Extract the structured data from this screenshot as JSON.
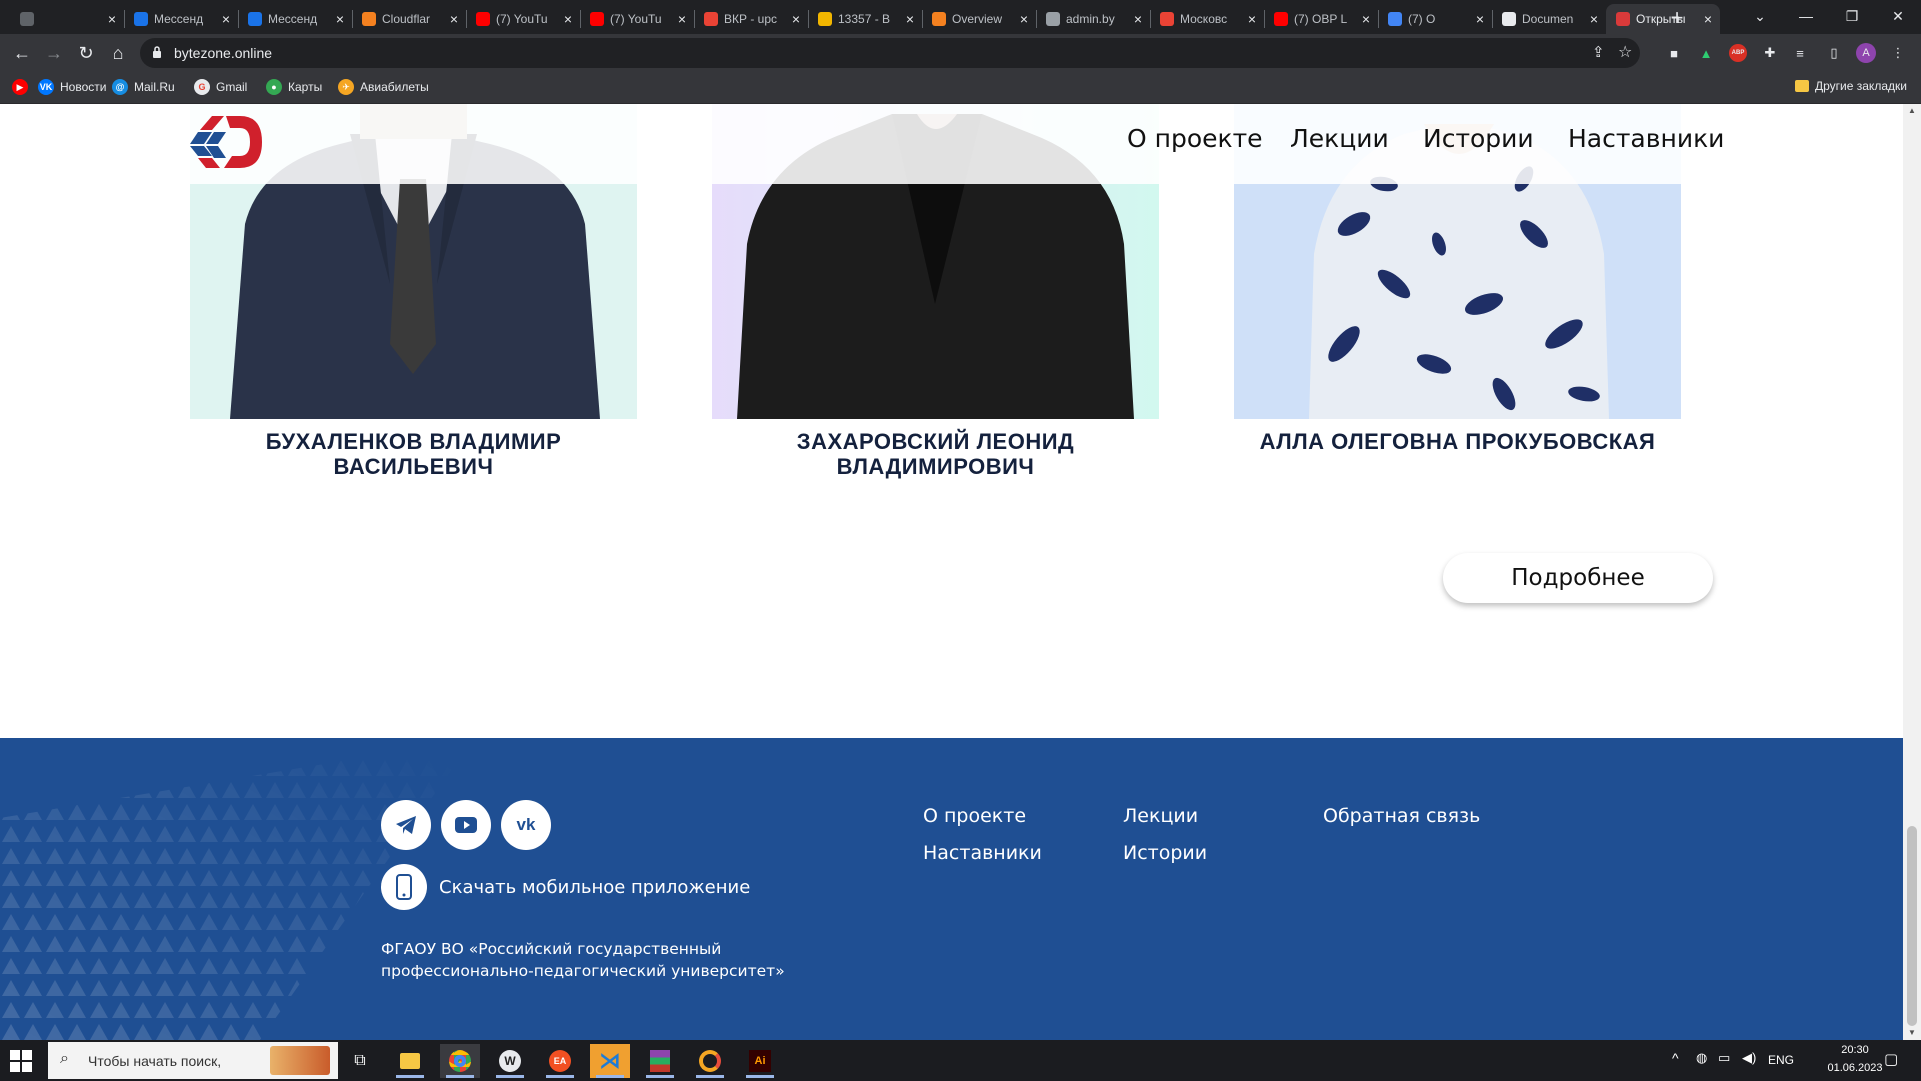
{
  "browser": {
    "tabs": [
      {
        "title": "",
        "color": "#5f6368"
      },
      {
        "title": "Мессенд",
        "color": "#1a73e8"
      },
      {
        "title": "Мессенд",
        "color": "#1a73e8"
      },
      {
        "title": "Cloudflar",
        "color": "#f48120"
      },
      {
        "title": "(7) YouTu",
        "color": "#ff0000"
      },
      {
        "title": "(7) YouTu",
        "color": "#ff0000"
      },
      {
        "title": "ВКР - upc",
        "color": "#ea4335"
      },
      {
        "title": "13357 - В",
        "color": "#f2b600"
      },
      {
        "title": "Overview",
        "color": "#f48120"
      },
      {
        "title": "admin.by",
        "color": "#9aa0a6"
      },
      {
        "title": "Московс",
        "color": "#ea4335"
      },
      {
        "title": "(7) OBP L",
        "color": "#ff0000"
      },
      {
        "title": "(7) О",
        "color": "#4285f4"
      },
      {
        "title": "Documen",
        "color": "#e8eaed"
      },
      {
        "title": "Открыты",
        "color": "#d93a3a"
      }
    ],
    "url": "bytezone.online",
    "bookmarks": [
      {
        "label": "",
        "color": "#ff0000",
        "glyph": "▶"
      },
      {
        "label": "Новости",
        "color": "#0077ff",
        "glyph": "VK"
      },
      {
        "label": "Mail.Ru",
        "color": "#168de2",
        "glyph": "@"
      },
      {
        "label": "Gmail",
        "color": "#e8eaed",
        "glyph": "G"
      },
      {
        "label": "Карты",
        "color": "#34a853",
        "glyph": "●"
      },
      {
        "label": "Авиабилеты",
        "color": "#f5a623",
        "glyph": "✈"
      }
    ],
    "other_bookmarks": "Другие закладки"
  },
  "header": {
    "nav": [
      "О проекте",
      "Лекции",
      "Истории",
      "Наставники"
    ]
  },
  "mentors": [
    {
      "name": "Бухаленков Владимир Васильевич",
      "bg": "#dff4f1"
    },
    {
      "name": "Захаровский Леонид Владимирович",
      "bg": "#e3e4fa"
    },
    {
      "name": "Алла Олеговна Прокубовская",
      "bg": "#cfe0f8"
    }
  ],
  "more_button": "Подробнее",
  "footer": {
    "social": [
      {
        "name": "telegram-icon"
      },
      {
        "name": "youtube-icon"
      },
      {
        "name": "vk-icon"
      }
    ],
    "app_download": "Скачать мобильное приложение",
    "org_line1": "ФГАОУ ВО «Российский государственный",
    "org_line2": "профессионально-педагогический университет»",
    "links": {
      "about": "О проекте",
      "lectures": "Лекции",
      "feedback": "Обратная связь",
      "mentors": "Наставники",
      "stories": "Истории"
    },
    "bg_color": "#1f4f93"
  },
  "taskbar": {
    "search_placeholder": "Чтобы начать поиск,",
    "lang": "ENG",
    "time": "20:30",
    "date": "01.06.2023"
  }
}
